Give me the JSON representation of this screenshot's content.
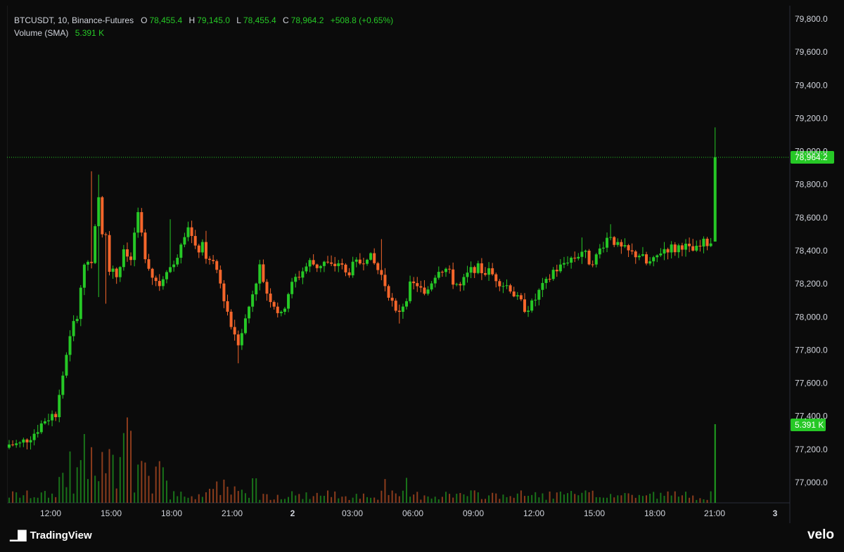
{
  "header": {
    "symbol_line": "BTCUSDT, 10, Binance-Futures",
    "open_key": "O",
    "open": "78,455.4",
    "high_key": "H",
    "high": "79,145.0",
    "low_key": "L",
    "low": "78,455.4",
    "close_key": "C",
    "close": "78,964.2",
    "change": "+508.8 (+0.65%)",
    "volume_label": "Volume (SMA)",
    "volume_value": "5.391 K"
  },
  "footer": {
    "brand": "TradingView",
    "watermark": "velo"
  },
  "colors": {
    "up": "#26c826",
    "down": "#f5662b",
    "background": "#0b0b0b",
    "text": "#d1d4dc"
  },
  "chart_data": {
    "type": "candlestick",
    "ylim": [
      76900,
      79900
    ],
    "y_ticks": [
      "77,000.0",
      "77,200.0",
      "77,400.0",
      "77,600.0",
      "77,800.0",
      "78,000.0",
      "78,200.0",
      "78,400.0",
      "78,600.0",
      "78,800.0",
      "79,000.0",
      "79,200.0",
      "79,400.0",
      "79,600.0",
      "79,800.0"
    ],
    "y_tick_values": [
      77000,
      77200,
      77400,
      77600,
      77800,
      78000,
      78200,
      78400,
      78600,
      78800,
      79000,
      79200,
      79400,
      79600,
      79800
    ],
    "x_ticks": [
      "12:00",
      "15:00",
      "18:00",
      "21:00",
      "2",
      "03:00",
      "06:00",
      "09:00",
      "12:00",
      "15:00",
      "18:00",
      "21:00",
      "3"
    ],
    "last_price_label": "78,964.2",
    "last_price": 78964.2,
    "volume_label": "5.391 K",
    "anchors": [
      [
        0,
        77230
      ],
      [
        3,
        77230
      ],
      [
        7,
        77300
      ],
      [
        10,
        77380
      ],
      [
        13,
        77420
      ],
      [
        15,
        77650
      ],
      [
        17,
        77900
      ],
      [
        19,
        78000
      ],
      [
        21,
        78320
      ],
      [
        23,
        78350
      ],
      [
        25,
        78700
      ],
      [
        26,
        78500
      ],
      [
        27,
        78520
      ],
      [
        28,
        78300
      ],
      [
        30,
        78250
      ],
      [
        32,
        78380
      ],
      [
        34,
        78350
      ],
      [
        36,
        78600
      ],
      [
        38,
        78380
      ],
      [
        40,
        78250
      ],
      [
        42,
        78200
      ],
      [
        44,
        78300
      ],
      [
        46,
        78300
      ],
      [
        48,
        78470
      ],
      [
        50,
        78560
      ],
      [
        52,
        78400
      ],
      [
        54,
        78420
      ],
      [
        56,
        78330
      ],
      [
        58,
        78280
      ],
      [
        60,
        78120
      ],
      [
        62,
        77950
      ],
      [
        64,
        77860
      ],
      [
        66,
        77980
      ],
      [
        68,
        78150
      ],
      [
        70,
        78300
      ],
      [
        72,
        78150
      ],
      [
        74,
        78080
      ],
      [
        76,
        78000
      ],
      [
        78,
        78150
      ],
      [
        80,
        78230
      ],
      [
        82,
        78280
      ],
      [
        84,
        78330
      ],
      [
        86,
        78310
      ],
      [
        88,
        78330
      ],
      [
        90,
        78300
      ],
      [
        92,
        78330
      ],
      [
        94,
        78260
      ],
      [
        96,
        78300
      ],
      [
        98,
        78330
      ],
      [
        100,
        78380
      ],
      [
        102,
        78320
      ],
      [
        104,
        78250
      ],
      [
        106,
        78150
      ],
      [
        108,
        78010
      ],
      [
        110,
        78080
      ],
      [
        112,
        78180
      ],
      [
        114,
        78200
      ],
      [
        116,
        78120
      ],
      [
        118,
        78220
      ],
      [
        120,
        78300
      ],
      [
        122,
        78290
      ],
      [
        124,
        78220
      ],
      [
        126,
        78180
      ],
      [
        128,
        78250
      ],
      [
        130,
        78300
      ],
      [
        132,
        78280
      ],
      [
        134,
        78270
      ],
      [
        136,
        78240
      ],
      [
        138,
        78200
      ],
      [
        140,
        78180
      ],
      [
        142,
        78100
      ],
      [
        144,
        78060
      ],
      [
        146,
        78070
      ],
      [
        148,
        78150
      ],
      [
        150,
        78200
      ],
      [
        152,
        78280
      ],
      [
        154,
        78300
      ],
      [
        156,
        78350
      ],
      [
        158,
        78360
      ],
      [
        160,
        78400
      ],
      [
        162,
        78340
      ],
      [
        164,
        78360
      ],
      [
        166,
        78450
      ],
      [
        168,
        78500
      ],
      [
        170,
        78420
      ],
      [
        172,
        78400
      ],
      [
        174,
        78380
      ],
      [
        176,
        78380
      ],
      [
        178,
        78320
      ],
      [
        180,
        78330
      ],
      [
        182,
        78400
      ],
      [
        184,
        78420
      ],
      [
        186,
        78410
      ],
      [
        188,
        78440
      ],
      [
        190,
        78400
      ],
      [
        192,
        78400
      ],
      [
        194,
        78440
      ],
      [
        196,
        78455
      ]
    ],
    "special_highs": [
      [
        23,
        78880
      ],
      [
        25,
        78860
      ],
      [
        36,
        78660
      ],
      [
        45,
        78590
      ],
      [
        55,
        78520
      ],
      [
        64,
        77720
      ],
      [
        104,
        78470
      ],
      [
        160,
        78480
      ],
      [
        168,
        78560
      ]
    ],
    "special_lows": [
      [
        25,
        78120
      ],
      [
        27,
        78080
      ],
      [
        64,
        77720
      ],
      [
        109,
        77960
      ],
      [
        146,
        78060
      ]
    ],
    "last_candle": {
      "open": 78455.4,
      "high": 79145.0,
      "low": 78455.4,
      "close": 78964.2
    }
  }
}
